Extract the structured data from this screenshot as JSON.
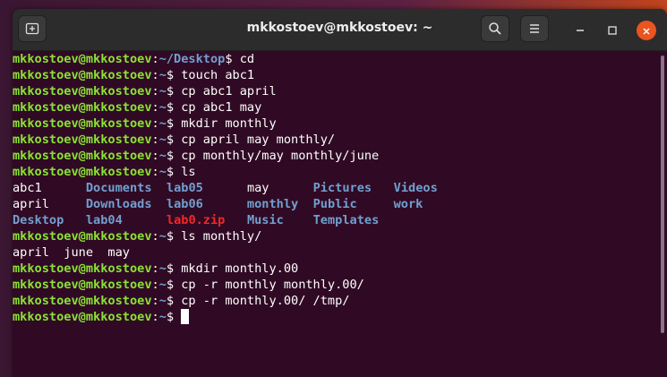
{
  "window": {
    "title": "mkkostoev@mkkostoev: ~",
    "icons": {
      "new_tab": "new-tab-icon",
      "search": "search-icon",
      "menu": "hamburger-menu-icon",
      "minimize": "minimize-icon",
      "maximize": "maximize-icon",
      "close": "close-icon"
    }
  },
  "colors": {
    "background": "#300a24",
    "user_host": "#8ae234",
    "path": "#729fcf",
    "directory": "#729fcf",
    "archive": "#ef2929",
    "close_button": "#e95420"
  },
  "terminal": {
    "lines": [
      {
        "type": "cmd",
        "user": "mkkostoev@mkkostoev",
        "path": "~/Desktop",
        "cmd": " cd"
      },
      {
        "type": "cmd",
        "user": "mkkostoev@mkkostoev",
        "path": "~",
        "cmd": " touch abc1"
      },
      {
        "type": "cmd",
        "user": "mkkostoev@mkkostoev",
        "path": "~",
        "cmd": " cp abc1 april"
      },
      {
        "type": "cmd",
        "user": "mkkostoev@mkkostoev",
        "path": "~",
        "cmd": " cp abc1 may"
      },
      {
        "type": "cmd",
        "user": "mkkostoev@mkkostoev",
        "path": "~",
        "cmd": " mkdir monthly"
      },
      {
        "type": "cmd",
        "user": "mkkostoev@mkkostoev",
        "path": "~",
        "cmd": " cp april may monthly/"
      },
      {
        "type": "cmd",
        "user": "mkkostoev@mkkostoev",
        "path": "~",
        "cmd": " cp monthly/may monthly/june"
      },
      {
        "type": "cmd",
        "user": "mkkostoev@mkkostoev",
        "path": "~",
        "cmd": " ls"
      },
      {
        "type": "ls",
        "items": [
          {
            "name": "abc1",
            "kind": "file"
          },
          {
            "name": "Documents",
            "kind": "dir"
          },
          {
            "name": "lab05",
            "kind": "dir"
          },
          {
            "name": "may",
            "kind": "file"
          },
          {
            "name": "Pictures",
            "kind": "dir"
          },
          {
            "name": "Videos",
            "kind": "dir"
          }
        ]
      },
      {
        "type": "ls",
        "items": [
          {
            "name": "april",
            "kind": "file"
          },
          {
            "name": "Downloads",
            "kind": "dir"
          },
          {
            "name": "lab06",
            "kind": "dir"
          },
          {
            "name": "monthly",
            "kind": "dir"
          },
          {
            "name": "Public",
            "kind": "dir"
          },
          {
            "name": "work",
            "kind": "dir"
          }
        ]
      },
      {
        "type": "ls",
        "items": [
          {
            "name": "Desktop",
            "kind": "dir"
          },
          {
            "name": "lab04",
            "kind": "dir"
          },
          {
            "name": "lab0.zip",
            "kind": "zip"
          },
          {
            "name": "Music",
            "kind": "dir"
          },
          {
            "name": "Templates",
            "kind": "dir"
          }
        ]
      },
      {
        "type": "cmd",
        "user": "mkkostoev@mkkostoev",
        "path": "~",
        "cmd": " ls monthly/"
      },
      {
        "type": "out",
        "text": "april  june  may"
      },
      {
        "type": "cmd",
        "user": "mkkostoev@mkkostoev",
        "path": "~",
        "cmd": " mkdir monthly.00"
      },
      {
        "type": "cmd",
        "user": "mkkostoev@mkkostoev",
        "path": "~",
        "cmd": " cp -r monthly monthly.00/"
      },
      {
        "type": "cmd",
        "user": "mkkostoev@mkkostoev",
        "path": "~",
        "cmd": " cp -r monthly.00/ /tmp/"
      },
      {
        "type": "prompt",
        "user": "mkkostoev@mkkostoev",
        "path": "~",
        "cmd": " "
      }
    ]
  }
}
